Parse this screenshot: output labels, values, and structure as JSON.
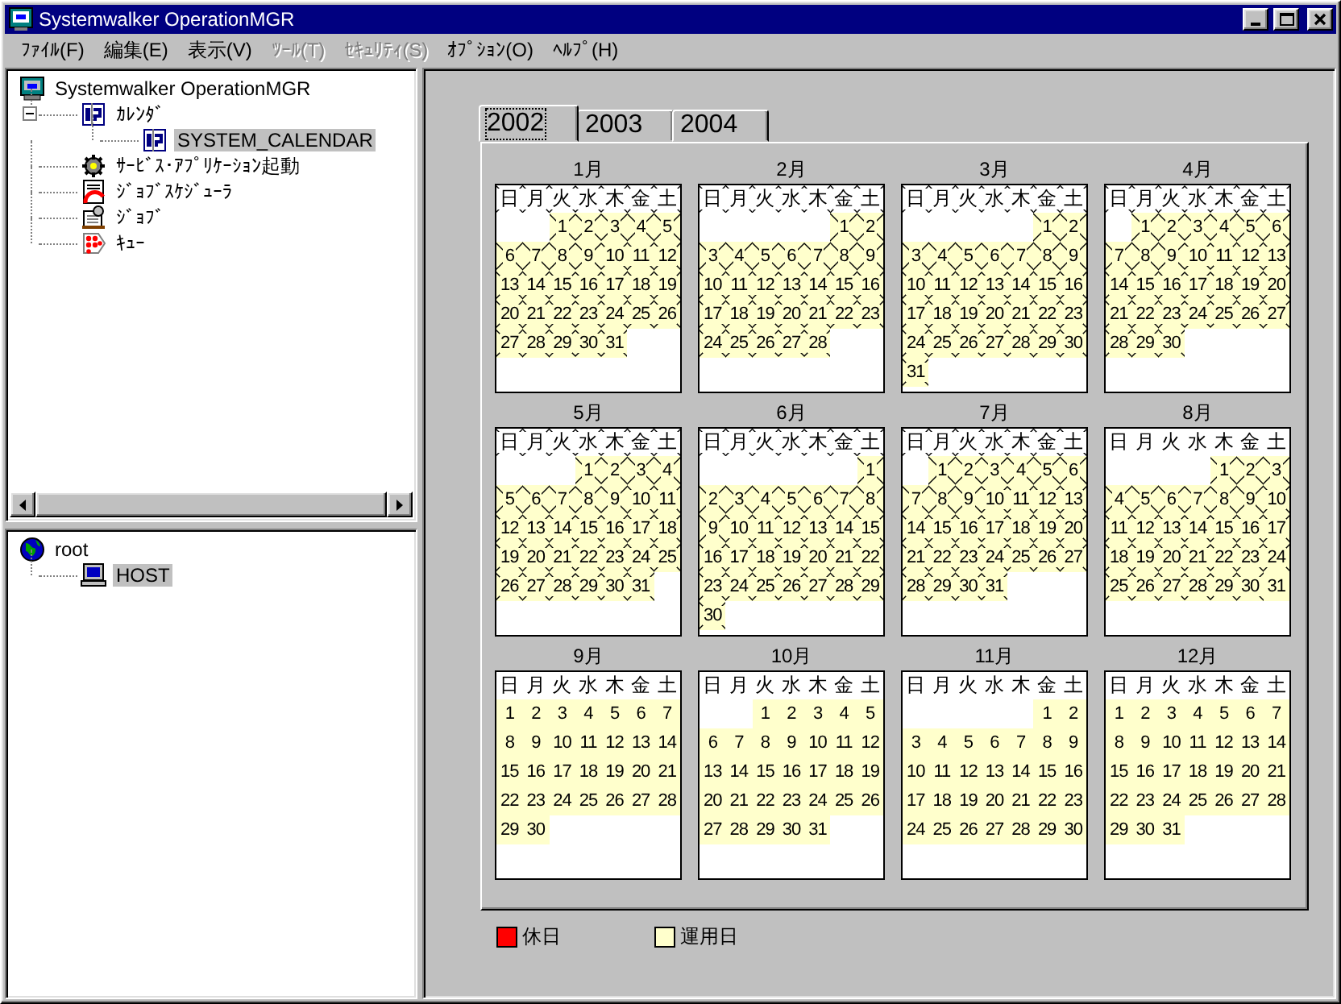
{
  "window": {
    "title": "Systemwalker OperationMGR"
  },
  "menu": [
    {
      "label": "ﾌｧｲﾙ(F)",
      "disabled": false
    },
    {
      "label": "編集(E)",
      "disabled": false
    },
    {
      "label": "表示(V)",
      "disabled": false
    },
    {
      "label": "ﾂｰﾙ(T)",
      "disabled": true
    },
    {
      "label": "ｾｷｭﾘﾃｨ(S)",
      "disabled": true
    },
    {
      "label": "ｵﾌﾟｼｮﾝ(O)",
      "disabled": false
    },
    {
      "label": "ﾍﾙﾌﾟ(H)",
      "disabled": false
    }
  ],
  "tree_top": [
    {
      "label": "Systemwalker OperationMGR",
      "kind": "system",
      "selected": false,
      "children": [
        {
          "label": "ｶﾚﾝﾀﾞ",
          "kind": "calendar",
          "expanded": true,
          "selected": false,
          "children": [
            {
              "label": "SYSTEM_CALENDAR",
              "kind": "calendar",
              "selected": true
            }
          ]
        },
        {
          "label": "ｻｰﾋﾞｽ･ｱﾌﾟﾘｹｰｼｮﾝ起動",
          "kind": "service",
          "selected": false
        },
        {
          "label": "ｼﾞｮﾌﾞｽｹｼﾞｭｰﾗ",
          "kind": "scheduler",
          "selected": false
        },
        {
          "label": "ｼﾞｮﾌﾞ",
          "kind": "job",
          "selected": false
        },
        {
          "label": "ｷｭｰ",
          "kind": "queue",
          "selected": false
        }
      ]
    }
  ],
  "tree_bottom": [
    {
      "label": "root",
      "kind": "globe",
      "selected": false,
      "children": [
        {
          "label": "HOST",
          "kind": "computer",
          "selected": true
        }
      ]
    }
  ],
  "tabs": [
    {
      "label": "2002",
      "selected": true
    },
    {
      "label": "2003",
      "selected": false
    },
    {
      "label": "2004",
      "selected": false
    }
  ],
  "months": [
    {
      "label": "1月",
      "weekdays": [
        "日",
        "月",
        "火",
        "水",
        "木",
        "金",
        "土"
      ],
      "weekdays_past": true,
      "weeks": [
        {
          "kind": "first",
          "days": [
            {
              "day": "1",
              "past": true
            },
            {
              "day": "2",
              "past": true
            },
            {
              "day": "3",
              "past": true
            },
            {
              "day": "4",
              "past": true
            },
            {
              "day": "5",
              "past": true
            }
          ]
        },
        {
          "kind": "week",
          "days": [
            {
              "day": "6",
              "past": true
            },
            {
              "day": "7",
              "past": true
            },
            {
              "day": "8",
              "past": true
            },
            {
              "day": "9",
              "past": true
            },
            {
              "day": "10",
              "past": true
            },
            {
              "day": "11",
              "past": true
            },
            {
              "day": "12",
              "past": true
            }
          ]
        },
        {
          "kind": "week",
          "days": [
            {
              "day": "13",
              "past": true
            },
            {
              "day": "14",
              "past": true
            },
            {
              "day": "15",
              "past": true
            },
            {
              "day": "16",
              "past": true
            },
            {
              "day": "17",
              "past": true
            },
            {
              "day": "18",
              "past": true
            },
            {
              "day": "19",
              "past": true
            }
          ]
        },
        {
          "kind": "week",
          "days": [
            {
              "day": "20",
              "past": true
            },
            {
              "day": "21",
              "past": true
            },
            {
              "day": "22",
              "past": true
            },
            {
              "day": "23",
              "past": true
            },
            {
              "day": "24",
              "past": true
            },
            {
              "day": "25",
              "past": true
            },
            {
              "day": "26",
              "past": true
            }
          ]
        },
        {
          "kind": "week",
          "days": [
            {
              "day": "27",
              "past": true
            },
            {
              "day": "28",
              "past": true
            },
            {
              "day": "29",
              "past": true
            },
            {
              "day": "30",
              "past": true
            },
            {
              "day": "31",
              "past": true
            }
          ]
        }
      ]
    },
    {
      "label": "2月",
      "weekdays": [
        "日",
        "月",
        "火",
        "水",
        "木",
        "金",
        "土"
      ],
      "weekdays_past": true,
      "weeks": [
        {
          "kind": "first",
          "days": [
            {
              "day": "1",
              "past": true
            },
            {
              "day": "2",
              "past": true
            }
          ]
        },
        {
          "kind": "week",
          "days": [
            {
              "day": "3",
              "past": true
            },
            {
              "day": "4",
              "past": true
            },
            {
              "day": "5",
              "past": true
            },
            {
              "day": "6",
              "past": true
            },
            {
              "day": "7",
              "past": true
            },
            {
              "day": "8",
              "past": true
            },
            {
              "day": "9",
              "past": true
            }
          ]
        },
        {
          "kind": "week",
          "days": [
            {
              "day": "10",
              "past": true
            },
            {
              "day": "11",
              "past": true
            },
            {
              "day": "12",
              "past": true
            },
            {
              "day": "13",
              "past": true
            },
            {
              "day": "14",
              "past": true
            },
            {
              "day": "15",
              "past": true
            },
            {
              "day": "16",
              "past": true
            }
          ]
        },
        {
          "kind": "week",
          "days": [
            {
              "day": "17",
              "past": true
            },
            {
              "day": "18",
              "past": true
            },
            {
              "day": "19",
              "past": true
            },
            {
              "day": "20",
              "past": true
            },
            {
              "day": "21",
              "past": true
            },
            {
              "day": "22",
              "past": true
            },
            {
              "day": "23",
              "past": true
            }
          ]
        },
        {
          "kind": "week",
          "days": [
            {
              "day": "24",
              "past": true
            },
            {
              "day": "25",
              "past": true
            },
            {
              "day": "26",
              "past": true
            },
            {
              "day": "27",
              "past": true
            },
            {
              "day": "28",
              "past": true
            }
          ]
        }
      ]
    },
    {
      "label": "3月",
      "weekdays": [
        "日",
        "月",
        "火",
        "水",
        "木",
        "金",
        "土"
      ],
      "weekdays_past": true,
      "weeks": [
        {
          "kind": "first",
          "days": [
            {
              "day": "1",
              "past": true
            },
            {
              "day": "2",
              "past": true
            }
          ]
        },
        {
          "kind": "week",
          "days": [
            {
              "day": "3",
              "past": true
            },
            {
              "day": "4",
              "past": true
            },
            {
              "day": "5",
              "past": true
            },
            {
              "day": "6",
              "past": true
            },
            {
              "day": "7",
              "past": true
            },
            {
              "day": "8",
              "past": true
            },
            {
              "day": "9",
              "past": true
            }
          ]
        },
        {
          "kind": "week",
          "days": [
            {
              "day": "10",
              "past": true
            },
            {
              "day": "11",
              "past": true
            },
            {
              "day": "12",
              "past": true
            },
            {
              "day": "13",
              "past": true
            },
            {
              "day": "14",
              "past": true
            },
            {
              "day": "15",
              "past": true
            },
            {
              "day": "16",
              "past": true
            }
          ]
        },
        {
          "kind": "week",
          "days": [
            {
              "day": "17",
              "past": true
            },
            {
              "day": "18",
              "past": true
            },
            {
              "day": "19",
              "past": true
            },
            {
              "day": "20",
              "past": true
            },
            {
              "day": "21",
              "past": true
            },
            {
              "day": "22",
              "past": true
            },
            {
              "day": "23",
              "past": true
            }
          ]
        },
        {
          "kind": "week",
          "days": [
            {
              "day": "24",
              "past": true
            },
            {
              "day": "25",
              "past": true
            },
            {
              "day": "26",
              "past": true
            },
            {
              "day": "27",
              "past": true
            },
            {
              "day": "28",
              "past": true
            },
            {
              "day": "29",
              "past": true
            },
            {
              "day": "30",
              "past": true
            }
          ]
        },
        {
          "kind": "week",
          "days": [
            {
              "day": "31",
              "past": true
            }
          ]
        }
      ]
    },
    {
      "label": "4月",
      "weekdays": [
        "日",
        "月",
        "火",
        "水",
        "木",
        "金",
        "土"
      ],
      "weekdays_past": true,
      "weeks": [
        {
          "kind": "first",
          "days": [
            {
              "day": "1",
              "past": true
            },
            {
              "day": "2",
              "past": true
            },
            {
              "day": "3",
              "past": true
            },
            {
              "day": "4",
              "past": true
            },
            {
              "day": "5",
              "past": true
            },
            {
              "day": "6",
              "past": true
            }
          ]
        },
        {
          "kind": "week",
          "days": [
            {
              "day": "7",
              "past": true
            },
            {
              "day": "8",
              "past": true
            },
            {
              "day": "9",
              "past": true
            },
            {
              "day": "10",
              "past": true
            },
            {
              "day": "11",
              "past": true
            },
            {
              "day": "12",
              "past": true
            },
            {
              "day": "13",
              "past": true
            }
          ]
        },
        {
          "kind": "week",
          "days": [
            {
              "day": "14",
              "past": true
            },
            {
              "day": "15",
              "past": true
            },
            {
              "day": "16",
              "past": true
            },
            {
              "day": "17",
              "past": true
            },
            {
              "day": "18",
              "past": true
            },
            {
              "day": "19",
              "past": true
            },
            {
              "day": "20",
              "past": true
            }
          ]
        },
        {
          "kind": "week",
          "days": [
            {
              "day": "21",
              "past": true
            },
            {
              "day": "22",
              "past": true
            },
            {
              "day": "23",
              "past": true
            },
            {
              "day": "24",
              "past": true
            },
            {
              "day": "25",
              "past": true
            },
            {
              "day": "26",
              "past": true
            },
            {
              "day": "27",
              "past": true
            }
          ]
        },
        {
          "kind": "week",
          "days": [
            {
              "day": "28",
              "past": true
            },
            {
              "day": "29",
              "past": true
            },
            {
              "day": "30",
              "past": true
            }
          ]
        }
      ]
    },
    {
      "label": "5月",
      "weekdays": [
        "日",
        "月",
        "火",
        "水",
        "木",
        "金",
        "土"
      ],
      "weekdays_past": true,
      "weeks": [
        {
          "kind": "first",
          "days": [
            {
              "day": "1",
              "past": true
            },
            {
              "day": "2",
              "past": true
            },
            {
              "day": "3",
              "past": true
            },
            {
              "day": "4",
              "past": true
            }
          ]
        },
        {
          "kind": "week",
          "days": [
            {
              "day": "5",
              "past": true
            },
            {
              "day": "6",
              "past": true
            },
            {
              "day": "7",
              "past": true
            },
            {
              "day": "8",
              "past": true
            },
            {
              "day": "9",
              "past": true
            },
            {
              "day": "10",
              "past": true
            },
            {
              "day": "11",
              "past": true
            }
          ]
        },
        {
          "kind": "week",
          "days": [
            {
              "day": "12",
              "past": true
            },
            {
              "day": "13",
              "past": true
            },
            {
              "day": "14",
              "past": true
            },
            {
              "day": "15",
              "past": true
            },
            {
              "day": "16",
              "past": true
            },
            {
              "day": "17",
              "past": true
            },
            {
              "day": "18",
              "past": true
            }
          ]
        },
        {
          "kind": "week",
          "days": [
            {
              "day": "19",
              "past": true
            },
            {
              "day": "20",
              "past": true
            },
            {
              "day": "21",
              "past": true
            },
            {
              "day": "22",
              "past": true
            },
            {
              "day": "23",
              "past": true
            },
            {
              "day": "24",
              "past": true
            },
            {
              "day": "25",
              "past": true
            }
          ]
        },
        {
          "kind": "week",
          "days": [
            {
              "day": "26",
              "past": true
            },
            {
              "day": "27",
              "past": true
            },
            {
              "day": "28",
              "past": true
            },
            {
              "day": "29",
              "past": true
            },
            {
              "day": "30",
              "past": true
            },
            {
              "day": "31",
              "past": true
            }
          ]
        }
      ]
    },
    {
      "label": "6月",
      "weekdays": [
        "日",
        "月",
        "火",
        "水",
        "木",
        "金",
        "土"
      ],
      "weekdays_past": true,
      "weeks": [
        {
          "kind": "first",
          "days": [
            {
              "day": "1",
              "past": true
            }
          ]
        },
        {
          "kind": "week",
          "days": [
            {
              "day": "2",
              "past": true
            },
            {
              "day": "3",
              "past": true
            },
            {
              "day": "4",
              "past": true
            },
            {
              "day": "5",
              "past": true
            },
            {
              "day": "6",
              "past": true
            },
            {
              "day": "7",
              "past": true
            },
            {
              "day": "8",
              "past": true
            }
          ]
        },
        {
          "kind": "week",
          "days": [
            {
              "day": "9",
              "past": true
            },
            {
              "day": "10",
              "past": true
            },
            {
              "day": "11",
              "past": true
            },
            {
              "day": "12",
              "past": true
            },
            {
              "day": "13",
              "past": true
            },
            {
              "day": "14",
              "past": true
            },
            {
              "day": "15",
              "past": true
            }
          ]
        },
        {
          "kind": "week",
          "days": [
            {
              "day": "16",
              "past": true
            },
            {
              "day": "17",
              "past": true
            },
            {
              "day": "18",
              "past": true
            },
            {
              "day": "19",
              "past": true
            },
            {
              "day": "20",
              "past": true
            },
            {
              "day": "21",
              "past": true
            },
            {
              "day": "22",
              "past": true
            }
          ]
        },
        {
          "kind": "week",
          "days": [
            {
              "day": "23",
              "past": true
            },
            {
              "day": "24",
              "past": true
            },
            {
              "day": "25",
              "past": true
            },
            {
              "day": "26",
              "past": true
            },
            {
              "day": "27",
              "past": true
            },
            {
              "day": "28",
              "past": true
            },
            {
              "day": "29",
              "past": true
            }
          ]
        },
        {
          "kind": "week",
          "days": [
            {
              "day": "30",
              "past": true
            }
          ]
        }
      ]
    },
    {
      "label": "7月",
      "weekdays": [
        "日",
        "月",
        "火",
        "水",
        "木",
        "金",
        "土"
      ],
      "weekdays_past": true,
      "weeks": [
        {
          "kind": "first",
          "days": [
            {
              "day": "1",
              "past": true
            },
            {
              "day": "2",
              "past": true
            },
            {
              "day": "3",
              "past": true
            },
            {
              "day": "4",
              "past": true
            },
            {
              "day": "5",
              "past": true
            },
            {
              "day": "6",
              "past": true
            }
          ]
        },
        {
          "kind": "week",
          "days": [
            {
              "day": "7",
              "past": true
            },
            {
              "day": "8",
              "past": true
            },
            {
              "day": "9",
              "past": true
            },
            {
              "day": "10",
              "past": true
            },
            {
              "day": "11",
              "past": true
            },
            {
              "day": "12",
              "past": true
            },
            {
              "day": "13",
              "past": true
            }
          ]
        },
        {
          "kind": "week",
          "days": [
            {
              "day": "14",
              "past": true
            },
            {
              "day": "15",
              "past": true
            },
            {
              "day": "16",
              "past": true
            },
            {
              "day": "17",
              "past": true
            },
            {
              "day": "18",
              "past": true
            },
            {
              "day": "19",
              "past": true
            },
            {
              "day": "20",
              "past": true
            }
          ]
        },
        {
          "kind": "week",
          "days": [
            {
              "day": "21",
              "past": true
            },
            {
              "day": "22",
              "past": true
            },
            {
              "day": "23",
              "past": true
            },
            {
              "day": "24",
              "past": true
            },
            {
              "day": "25",
              "past": true
            },
            {
              "day": "26",
              "past": true
            },
            {
              "day": "27",
              "past": true
            }
          ]
        },
        {
          "kind": "week",
          "days": [
            {
              "day": "28",
              "past": true
            },
            {
              "day": "29",
              "past": true
            },
            {
              "day": "30",
              "past": true
            },
            {
              "day": "31",
              "past": true
            }
          ]
        }
      ]
    },
    {
      "label": "8月",
      "weekdays": [
        "日",
        "月",
        "火",
        "水",
        "木",
        "金",
        "土"
      ],
      "weekdays_past": false,
      "weeks": [
        {
          "kind": "first",
          "days": [
            {
              "day": "1",
              "past": true
            },
            {
              "day": "2",
              "past": true
            },
            {
              "day": "3",
              "past": true
            }
          ]
        },
        {
          "kind": "week",
          "days": [
            {
              "day": "4",
              "past": true
            },
            {
              "day": "5",
              "past": true
            },
            {
              "day": "6",
              "past": true
            },
            {
              "day": "7",
              "past": true
            },
            {
              "day": "8",
              "past": true
            },
            {
              "day": "9",
              "past": true
            },
            {
              "day": "10",
              "past": true
            }
          ]
        },
        {
          "kind": "week",
          "days": [
            {
              "day": "11",
              "past": true
            },
            {
              "day": "12",
              "past": true
            },
            {
              "day": "13",
              "past": true
            },
            {
              "day": "14",
              "past": true
            },
            {
              "day": "15",
              "past": true
            },
            {
              "day": "16",
              "past": true
            },
            {
              "day": "17",
              "past": true
            }
          ]
        },
        {
          "kind": "week",
          "days": [
            {
              "day": "18",
              "past": true
            },
            {
              "day": "19",
              "past": true
            },
            {
              "day": "20",
              "past": true
            },
            {
              "day": "21",
              "past": true
            },
            {
              "day": "22",
              "past": true
            },
            {
              "day": "23",
              "past": true
            },
            {
              "day": "24",
              "past": true
            }
          ]
        },
        {
          "kind": "week",
          "days": [
            {
              "day": "25",
              "past": true
            },
            {
              "day": "26",
              "past": true
            },
            {
              "day": "27",
              "past": true
            },
            {
              "day": "28",
              "past": true
            },
            {
              "day": "29",
              "past": true
            },
            {
              "day": "30",
              "past": true
            },
            {
              "day": "31",
              "past": false
            }
          ]
        }
      ]
    },
    {
      "label": "9月",
      "weekdays": [
        "日",
        "月",
        "火",
        "水",
        "木",
        "金",
        "土"
      ],
      "weekdays_past": false,
      "weeks": [
        {
          "kind": "week",
          "days": [
            {
              "day": "1",
              "past": false
            },
            {
              "day": "2",
              "past": false
            },
            {
              "day": "3",
              "past": false
            },
            {
              "day": "4",
              "past": false
            },
            {
              "day": "5",
              "past": false
            },
            {
              "day": "6",
              "past": false
            },
            {
              "day": "7",
              "past": false
            }
          ]
        },
        {
          "kind": "week",
          "days": [
            {
              "day": "8",
              "past": false
            },
            {
              "day": "9",
              "past": false
            },
            {
              "day": "10",
              "past": false
            },
            {
              "day": "11",
              "past": false
            },
            {
              "day": "12",
              "past": false
            },
            {
              "day": "13",
              "past": false
            },
            {
              "day": "14",
              "past": false
            }
          ]
        },
        {
          "kind": "week",
          "days": [
            {
              "day": "15",
              "past": false
            },
            {
              "day": "16",
              "past": false
            },
            {
              "day": "17",
              "past": false
            },
            {
              "day": "18",
              "past": false
            },
            {
              "day": "19",
              "past": false
            },
            {
              "day": "20",
              "past": false
            },
            {
              "day": "21",
              "past": false
            }
          ]
        },
        {
          "kind": "week",
          "days": [
            {
              "day": "22",
              "past": false
            },
            {
              "day": "23",
              "past": false
            },
            {
              "day": "24",
              "past": false
            },
            {
              "day": "25",
              "past": false
            },
            {
              "day": "26",
              "past": false
            },
            {
              "day": "27",
              "past": false
            },
            {
              "day": "28",
              "past": false
            }
          ]
        },
        {
          "kind": "week",
          "days": [
            {
              "day": "29",
              "past": false
            },
            {
              "day": "30",
              "past": false
            }
          ]
        }
      ]
    },
    {
      "label": "10月",
      "weekdays": [
        "日",
        "月",
        "火",
        "水",
        "木",
        "金",
        "土"
      ],
      "weekdays_past": false,
      "weeks": [
        {
          "kind": "first",
          "days": [
            {
              "day": "1",
              "past": false
            },
            {
              "day": "2",
              "past": false
            },
            {
              "day": "3",
              "past": false
            },
            {
              "day": "4",
              "past": false
            },
            {
              "day": "5",
              "past": false
            }
          ]
        },
        {
          "kind": "week",
          "days": [
            {
              "day": "6",
              "past": false
            },
            {
              "day": "7",
              "past": false
            },
            {
              "day": "8",
              "past": false
            },
            {
              "day": "9",
              "past": false
            },
            {
              "day": "10",
              "past": false
            },
            {
              "day": "11",
              "past": false
            },
            {
              "day": "12",
              "past": false
            }
          ]
        },
        {
          "kind": "week",
          "days": [
            {
              "day": "13",
              "past": false
            },
            {
              "day": "14",
              "past": false
            },
            {
              "day": "15",
              "past": false
            },
            {
              "day": "16",
              "past": false
            },
            {
              "day": "17",
              "past": false
            },
            {
              "day": "18",
              "past": false
            },
            {
              "day": "19",
              "past": false
            }
          ]
        },
        {
          "kind": "week",
          "days": [
            {
              "day": "20",
              "past": false
            },
            {
              "day": "21",
              "past": false
            },
            {
              "day": "22",
              "past": false
            },
            {
              "day": "23",
              "past": false
            },
            {
              "day": "24",
              "past": false
            },
            {
              "day": "25",
              "past": false
            },
            {
              "day": "26",
              "past": false
            }
          ]
        },
        {
          "kind": "week",
          "days": [
            {
              "day": "27",
              "past": false
            },
            {
              "day": "28",
              "past": false
            },
            {
              "day": "29",
              "past": false
            },
            {
              "day": "30",
              "past": false
            },
            {
              "day": "31",
              "past": false
            }
          ]
        }
      ]
    },
    {
      "label": "11月",
      "weekdays": [
        "日",
        "月",
        "火",
        "水",
        "木",
        "金",
        "土"
      ],
      "weekdays_past": false,
      "weeks": [
        {
          "kind": "first",
          "days": [
            {
              "day": "1",
              "past": false
            },
            {
              "day": "2",
              "past": false
            }
          ]
        },
        {
          "kind": "week",
          "days": [
            {
              "day": "3",
              "past": false
            },
            {
              "day": "4",
              "past": false
            },
            {
              "day": "5",
              "past": false
            },
            {
              "day": "6",
              "past": false
            },
            {
              "day": "7",
              "past": false
            },
            {
              "day": "8",
              "past": false
            },
            {
              "day": "9",
              "past": false
            }
          ]
        },
        {
          "kind": "week",
          "days": [
            {
              "day": "10",
              "past": false
            },
            {
              "day": "11",
              "past": false
            },
            {
              "day": "12",
              "past": false
            },
            {
              "day": "13",
              "past": false
            },
            {
              "day": "14",
              "past": false
            },
            {
              "day": "15",
              "past": false
            },
            {
              "day": "16",
              "past": false
            }
          ]
        },
        {
          "kind": "week",
          "days": [
            {
              "day": "17",
              "past": false
            },
            {
              "day": "18",
              "past": false
            },
            {
              "day": "19",
              "past": false
            },
            {
              "day": "20",
              "past": false
            },
            {
              "day": "21",
              "past": false
            },
            {
              "day": "22",
              "past": false
            },
            {
              "day": "23",
              "past": false
            }
          ]
        },
        {
          "kind": "week",
          "days": [
            {
              "day": "24",
              "past": false
            },
            {
              "day": "25",
              "past": false
            },
            {
              "day": "26",
              "past": false
            },
            {
              "day": "27",
              "past": false
            },
            {
              "day": "28",
              "past": false
            },
            {
              "day": "29",
              "past": false
            },
            {
              "day": "30",
              "past": false
            }
          ]
        }
      ]
    },
    {
      "label": "12月",
      "weekdays": [
        "日",
        "月",
        "火",
        "水",
        "木",
        "金",
        "土"
      ],
      "weekdays_past": false,
      "weeks": [
        {
          "kind": "week",
          "days": [
            {
              "day": "1",
              "past": false
            },
            {
              "day": "2",
              "past": false
            },
            {
              "day": "3",
              "past": false
            },
            {
              "day": "4",
              "past": false
            },
            {
              "day": "5",
              "past": false
            },
            {
              "day": "6",
              "past": false
            },
            {
              "day": "7",
              "past": false
            }
          ]
        },
        {
          "kind": "week",
          "days": [
            {
              "day": "8",
              "past": false
            },
            {
              "day": "9",
              "past": false
            },
            {
              "day": "10",
              "past": false
            },
            {
              "day": "11",
              "past": false
            },
            {
              "day": "12",
              "past": false
            },
            {
              "day": "13",
              "past": false
            },
            {
              "day": "14",
              "past": false
            }
          ]
        },
        {
          "kind": "week",
          "days": [
            {
              "day": "15",
              "past": false
            },
            {
              "day": "16",
              "past": false
            },
            {
              "day": "17",
              "past": false
            },
            {
              "day": "18",
              "past": false
            },
            {
              "day": "19",
              "past": false
            },
            {
              "day": "20",
              "past": false
            },
            {
              "day": "21",
              "past": false
            }
          ]
        },
        {
          "kind": "week",
          "days": [
            {
              "day": "22",
              "past": false
            },
            {
              "day": "23",
              "past": false
            },
            {
              "day": "24",
              "past": false
            },
            {
              "day": "25",
              "past": false
            },
            {
              "day": "26",
              "past": false
            },
            {
              "day": "27",
              "past": false
            },
            {
              "day": "28",
              "past": false
            }
          ]
        },
        {
          "kind": "week",
          "days": [
            {
              "day": "29",
              "past": false
            },
            {
              "day": "30",
              "past": false
            },
            {
              "day": "31",
              "past": false
            }
          ]
        }
      ]
    }
  ],
  "legend": [
    {
      "label": "休日",
      "color": "#ff0000"
    },
    {
      "label": "運用日",
      "color": "#ffffcc"
    }
  ]
}
